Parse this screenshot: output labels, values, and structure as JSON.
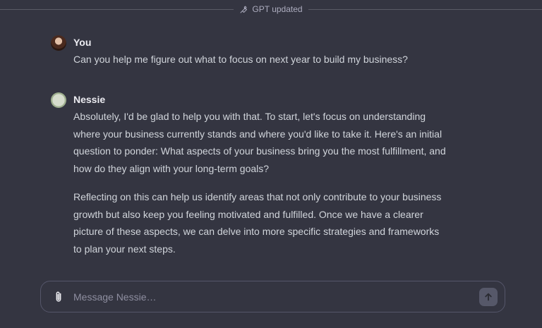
{
  "divider": {
    "label": "GPT updated",
    "icon": "wrench-icon"
  },
  "messages": [
    {
      "role": "user",
      "author": "You",
      "avatar": "user-avatar",
      "paragraphs": [
        "Can you help me figure out what to focus on next year to build my business?"
      ]
    },
    {
      "role": "assistant",
      "author": "Nessie",
      "avatar": "nessie-avatar",
      "paragraphs": [
        "Absolutely, I'd be glad to help you with that. To start, let's focus on understanding where your business currently stands and where you'd like to take it. Here's an initial question to ponder: What aspects of your business bring you the most fulfillment, and how do they align with your long-term goals?",
        "Reflecting on this can help us identify areas that not only contribute to your business growth but also keep you feeling motivated and fulfilled. Once we have a clearer picture of these aspects, we can delve into more specific strategies and frameworks to plan your next steps."
      ]
    }
  ],
  "composer": {
    "placeholder": "Message Nessie…",
    "value": "",
    "attach_icon": "paperclip-icon",
    "send_icon": "arrow-up-icon"
  },
  "colors": {
    "background": "#343541",
    "text": "#ececf1",
    "muted": "#acacbe",
    "send_button": "#565869"
  }
}
